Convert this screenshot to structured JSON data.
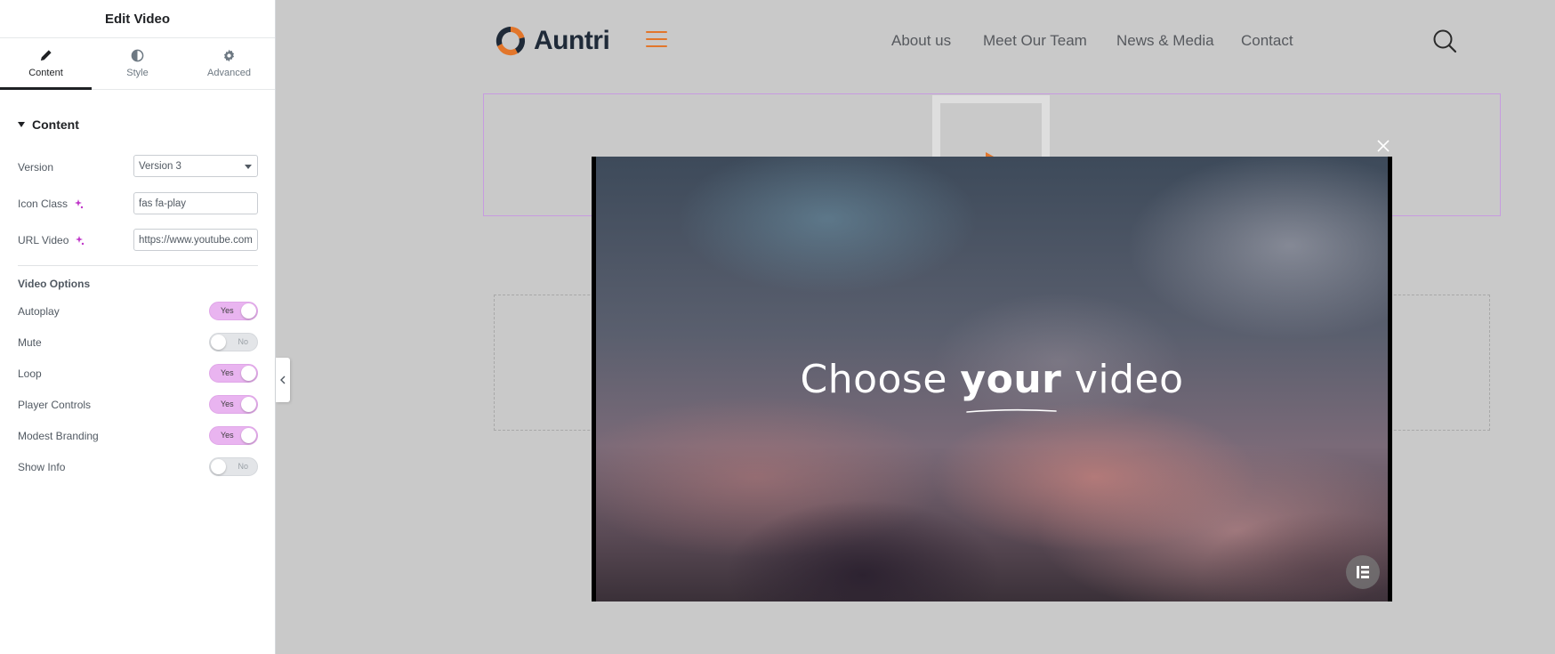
{
  "panel": {
    "title": "Edit Video",
    "tabs": [
      {
        "label": "Content",
        "icon": "pencil-icon"
      },
      {
        "label": "Style",
        "icon": "half-circle-icon"
      },
      {
        "label": "Advanced",
        "icon": "gear-icon"
      }
    ],
    "section_title": "Content",
    "version": {
      "label": "Version",
      "value": "Version 3"
    },
    "icon_class": {
      "label": "Icon Class",
      "value": "fas fa-play"
    },
    "url_video": {
      "label": "URL Video",
      "value": "https://www.youtube.com/"
    },
    "video_options_heading": "Video Options",
    "toggles": [
      {
        "label": "Autoplay",
        "state": "Yes"
      },
      {
        "label": "Mute",
        "state": "No"
      },
      {
        "label": "Loop",
        "state": "Yes"
      },
      {
        "label": "Player Controls",
        "state": "Yes"
      },
      {
        "label": "Modest Branding",
        "state": "Yes"
      },
      {
        "label": "Show Info",
        "state": "No"
      }
    ]
  },
  "site": {
    "logo_text": "Auntri",
    "nav": [
      "About us",
      "Meet Our Team",
      "News & Media",
      "Contact"
    ],
    "accent_color": "#e2762b"
  },
  "lightbox": {
    "title_prefix": "Choose ",
    "title_bold": "your",
    "title_suffix": " video"
  },
  "colors": {
    "toggle_on": "#e9b4f0",
    "selection_border": "#c79be0",
    "brand_orange": "#e2762b"
  }
}
